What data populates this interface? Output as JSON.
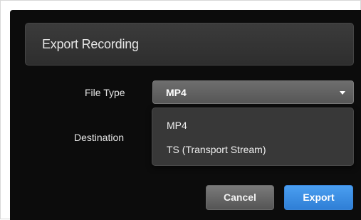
{
  "dialog": {
    "title": "Export Recording"
  },
  "form": {
    "file_type_label": "File Type",
    "destination_label": "Destination",
    "file_type_selected": "MP4",
    "file_type_options": [
      "MP4",
      "TS (Transport Stream)"
    ]
  },
  "actions": {
    "cancel_label": "Cancel",
    "export_label": "Export"
  },
  "colors": {
    "dialog_background": "#0c0c0c",
    "primary_button": "#3a8ee6",
    "secondary_button": "#666666"
  },
  "icons": {
    "dropdown_caret": "chevron-down-icon"
  }
}
